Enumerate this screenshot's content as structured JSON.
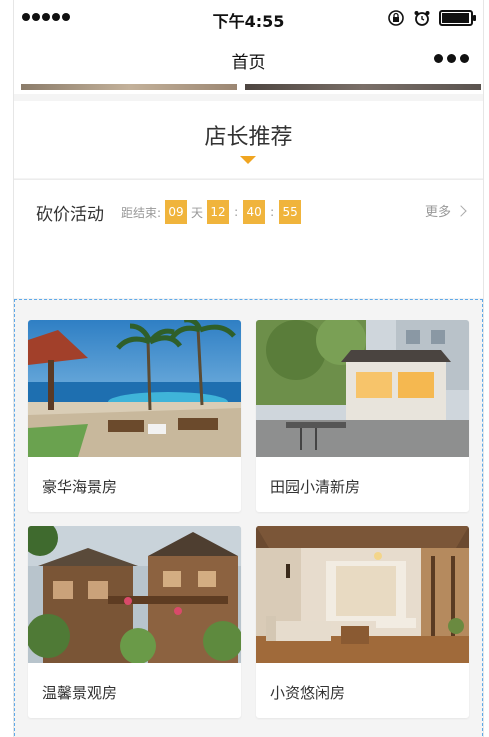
{
  "status_bar": {
    "time": "下午4:55",
    "signal_dots": 5,
    "battery_level": 0.95
  },
  "nav": {
    "title": "首页",
    "more_icon": "more-dots-icon"
  },
  "section": {
    "title": "店长推荐"
  },
  "bargain": {
    "title": "砍价活动",
    "countdown_label": "距结束:",
    "days": "09",
    "day_unit": "天",
    "hours": "12",
    "minutes": "40",
    "seconds": "55",
    "separator": ":",
    "more_label": "更多"
  },
  "colors": {
    "accent": "#f0a521",
    "countdown_bg": "#f0b43c",
    "grid_border": "#5fa9e8"
  },
  "rooms": [
    {
      "name": "豪华海景房",
      "image": "seaview-pool-photo"
    },
    {
      "name": "田园小清新房",
      "image": "garden-house-photo"
    },
    {
      "name": "温馨景观房",
      "image": "wooden-villa-photo"
    },
    {
      "name": "小资悠闲房",
      "image": "living-room-photo"
    }
  ]
}
